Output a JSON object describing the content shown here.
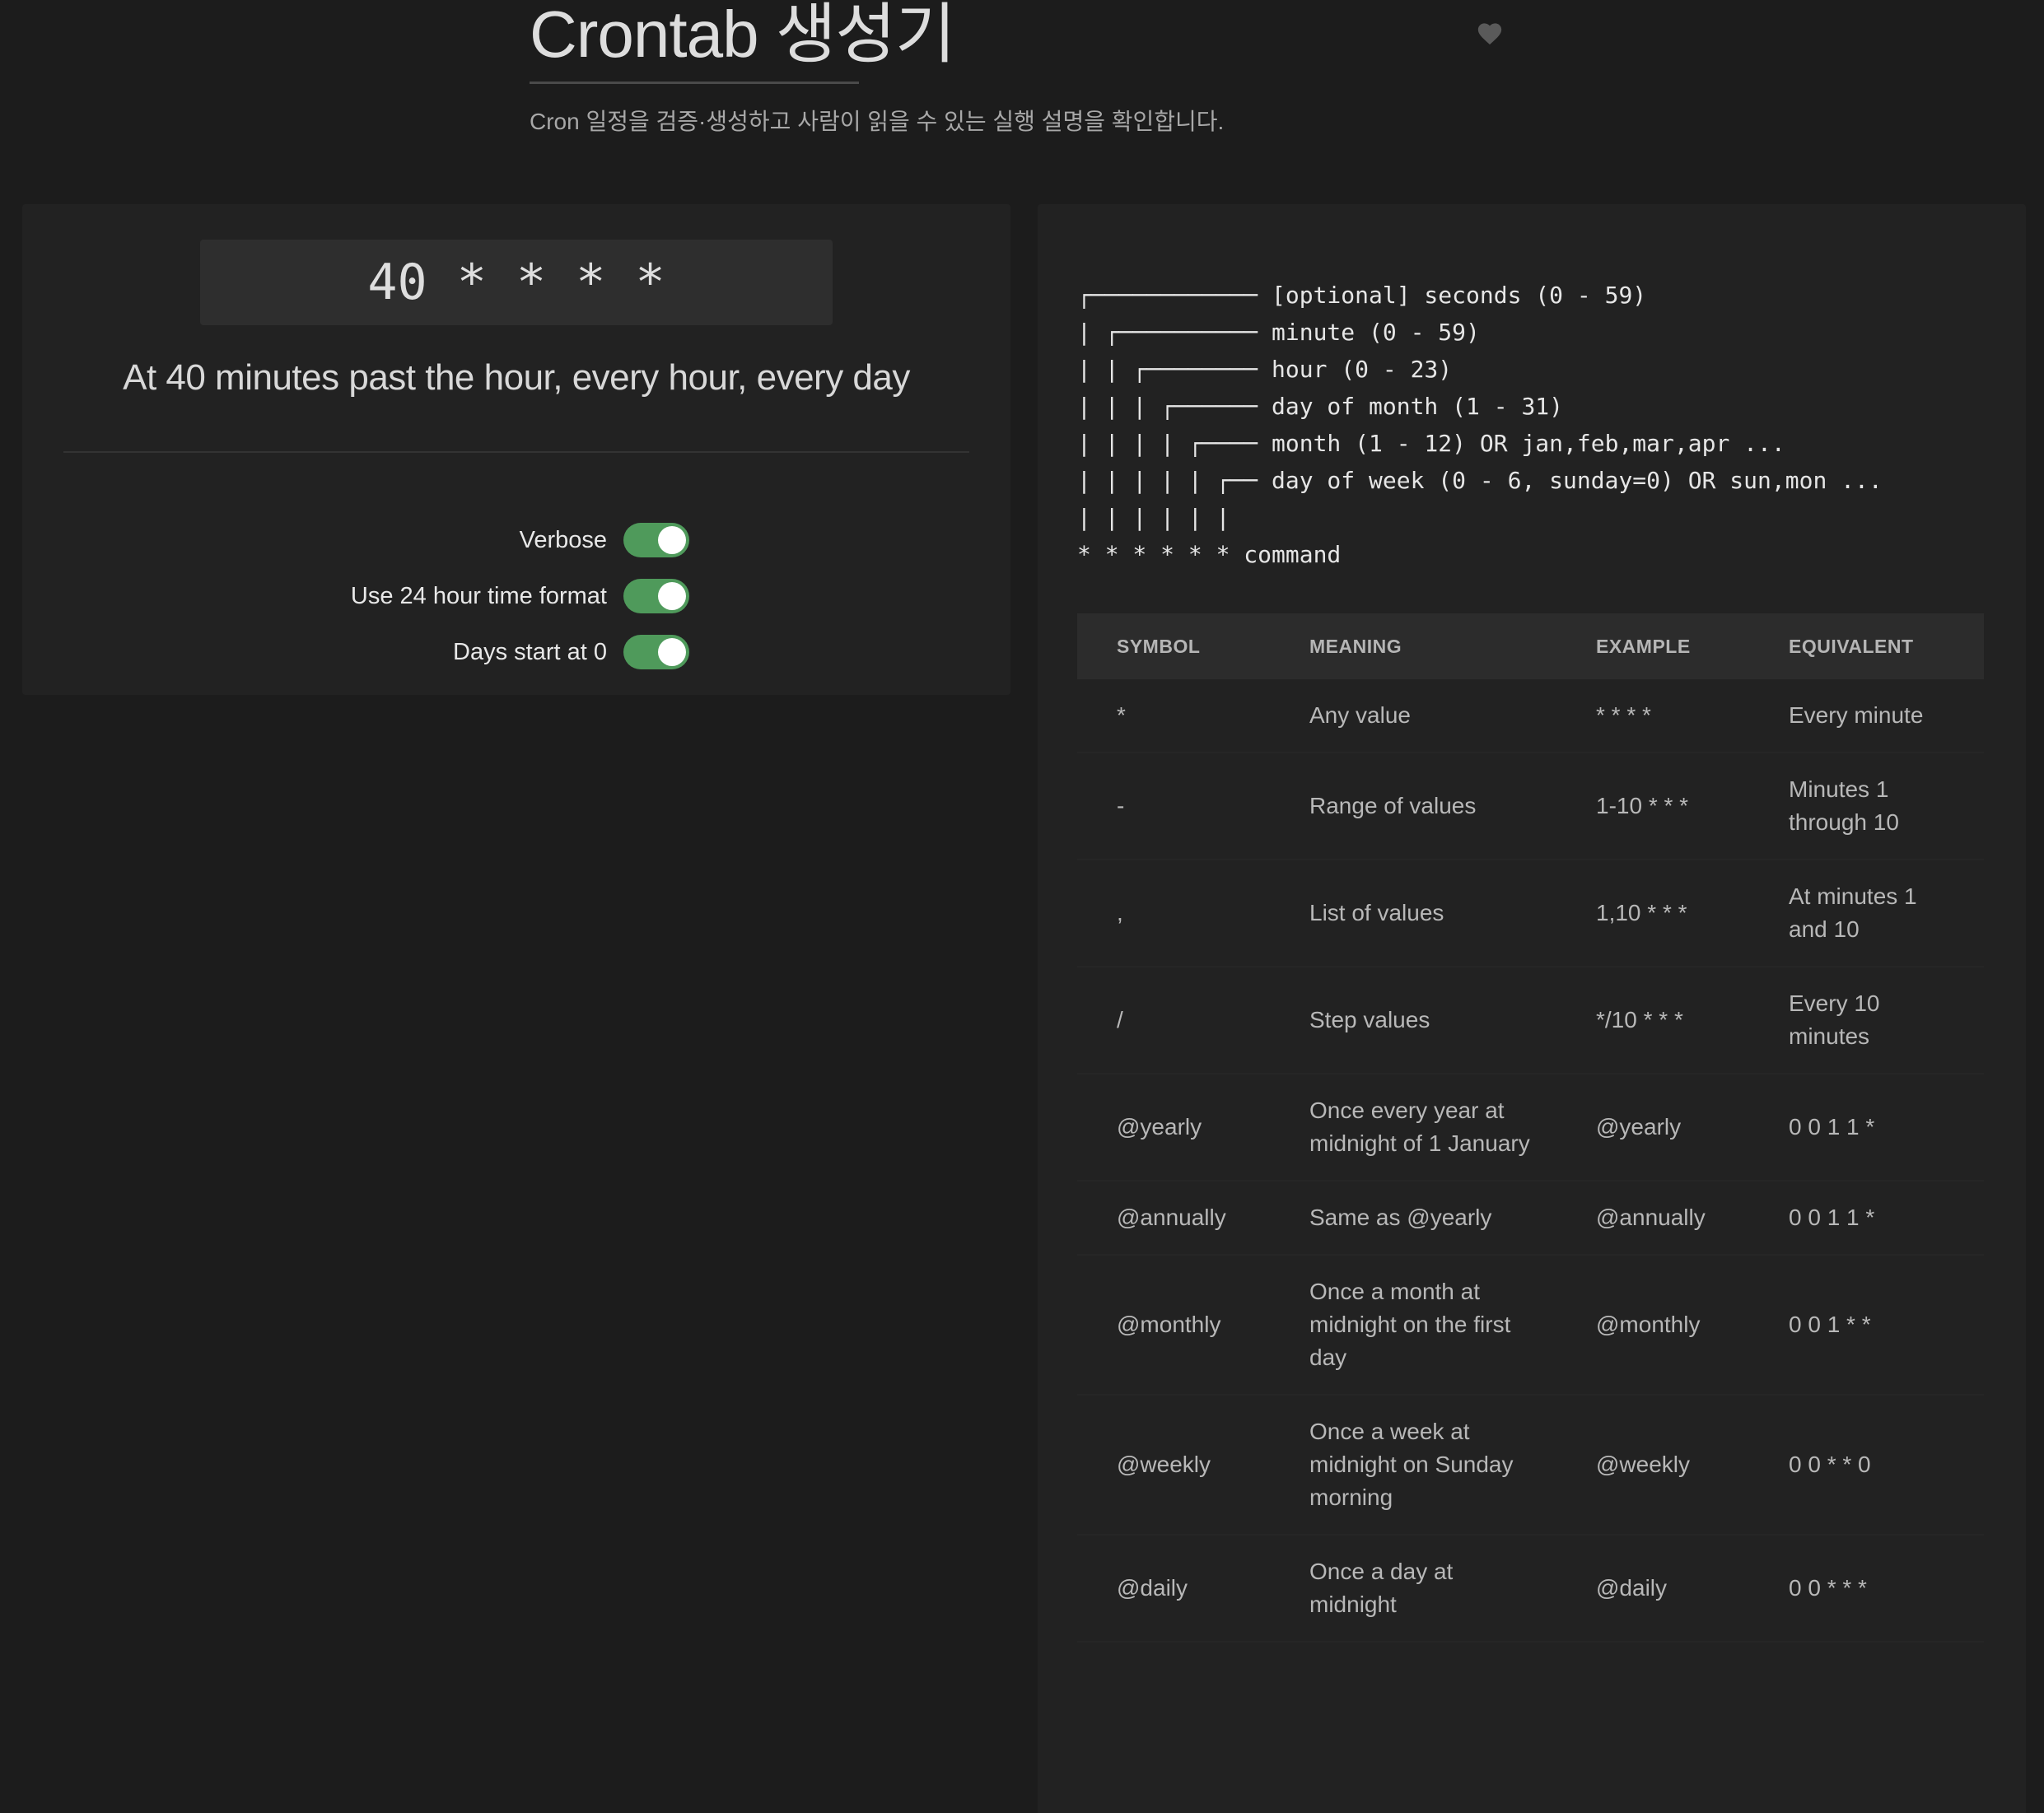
{
  "header": {
    "title": "Crontab 생성기",
    "subtitle": "Cron 일정을 검증·생성하고 사람이 읽을 수 있는 실행 설명을 확인합니다.",
    "favorite_icon": "heart-icon"
  },
  "editor": {
    "expression": "40 * * * *",
    "description": "At 40 minutes past the hour, every hour, every day",
    "options": [
      {
        "label": "Verbose",
        "enabled": true
      },
      {
        "label": "Use 24 hour time format",
        "enabled": true
      },
      {
        "label": "Days start at 0",
        "enabled": true
      }
    ]
  },
  "diagram": {
    "lines": [
      "┌──────────── [optional] seconds (0 - 59)",
      "| ┌────────── minute (0 - 59)",
      "| | ┌──────── hour (0 - 23)",
      "| | | ┌────── day of month (1 - 31)",
      "| | | | ┌──── month (1 - 12) OR jan,feb,mar,apr ...",
      "| | | | | ┌── day of week (0 - 6, sunday=0) OR sun,mon ...",
      "| | | | | |",
      "* * * * * * command"
    ]
  },
  "table": {
    "headers": [
      "SYMBOL",
      "MEANING",
      "EXAMPLE",
      "EQUIVALENT"
    ],
    "rows": [
      [
        "*",
        "Any value",
        "* * * *",
        "Every minute"
      ],
      [
        "-",
        "Range of values",
        "1-10 * * *",
        "Minutes 1 through 10"
      ],
      [
        ",",
        "List of values",
        "1,10 * * *",
        "At minutes 1 and 10"
      ],
      [
        "/",
        "Step values",
        "*/10 * * *",
        "Every 10 minutes"
      ],
      [
        "@yearly",
        "Once every year at midnight of 1 January",
        "@yearly",
        "0 0 1 1 *"
      ],
      [
        "@annually",
        "Same as @yearly",
        "@annually",
        "0 0 1 1 *"
      ],
      [
        "@monthly",
        "Once a month at midnight on the first day",
        "@monthly",
        "0 0 1 * *"
      ],
      [
        "@weekly",
        "Once a week at midnight on Sunday morning",
        "@weekly",
        "0 0 * * 0"
      ],
      [
        "@daily",
        "Once a day at midnight",
        "@daily",
        "0 0 * * *"
      ]
    ]
  },
  "colors": {
    "background": "#1c1c1c",
    "card": "#222222",
    "toggle_on": "#4f9a5b",
    "table_header": "#2c2c2c"
  }
}
